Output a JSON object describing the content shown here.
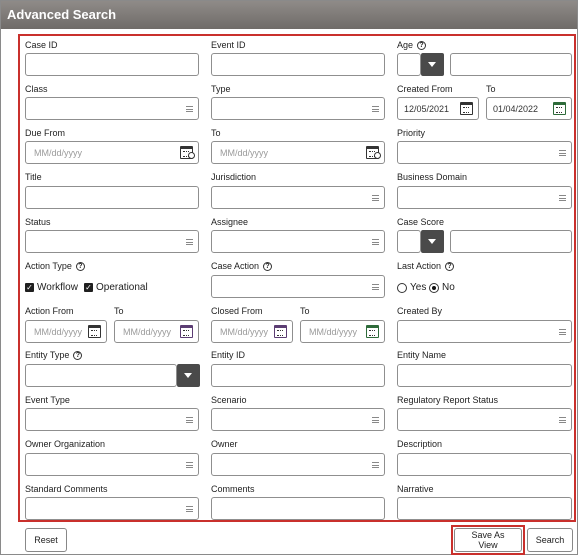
{
  "window": {
    "title": "Advanced Search"
  },
  "fields": {
    "case_id": {
      "label": "Case ID"
    },
    "event_id": {
      "label": "Event ID"
    },
    "age": {
      "label": "Age"
    },
    "class": {
      "label": "Class"
    },
    "type": {
      "label": "Type"
    },
    "created_from": {
      "label": "Created From",
      "value": "12/05/2021"
    },
    "created_to": {
      "label": "To",
      "value": "01/04/2022"
    },
    "due_from": {
      "label": "Due From",
      "placeholder": "MM/dd/yyyy"
    },
    "due_to": {
      "label": "To",
      "placeholder": "MM/dd/yyyy"
    },
    "priority": {
      "label": "Priority"
    },
    "title": {
      "label": "Title"
    },
    "jurisdiction": {
      "label": "Jurisdiction"
    },
    "business_domain": {
      "label": "Business Domain"
    },
    "status": {
      "label": "Status"
    },
    "assignee": {
      "label": "Assignee"
    },
    "case_score": {
      "label": "Case Score"
    },
    "action_type": {
      "label": "Action Type",
      "options": [
        "Workflow",
        "Operational"
      ]
    },
    "case_action": {
      "label": "Case Action"
    },
    "last_action": {
      "label": "Last Action",
      "options": [
        "Yes",
        "No"
      ],
      "selected": "No"
    },
    "action_from": {
      "label": "Action From",
      "placeholder": "MM/dd/yyyy"
    },
    "action_to": {
      "label": "To",
      "placeholder": "MM/dd/yyyy"
    },
    "closed_from": {
      "label": "Closed From",
      "placeholder": "MM/dd/yyyy"
    },
    "closed_to": {
      "label": "To",
      "placeholder": "MM/dd/yyyy"
    },
    "created_by": {
      "label": "Created By"
    },
    "entity_type": {
      "label": "Entity Type"
    },
    "entity_id": {
      "label": "Entity ID"
    },
    "entity_name": {
      "label": "Entity Name"
    },
    "event_type": {
      "label": "Event Type"
    },
    "scenario": {
      "label": "Scenario"
    },
    "regulatory_report_status": {
      "label": "Regulatory Report Status"
    },
    "owner_organization": {
      "label": "Owner Organization"
    },
    "owner": {
      "label": "Owner"
    },
    "description": {
      "label": "Description"
    },
    "standard_comments": {
      "label": "Standard Comments"
    },
    "comments": {
      "label": "Comments"
    },
    "narrative": {
      "label": "Narrative"
    }
  },
  "footer": {
    "reset": "Reset",
    "save_as_view": "Save As View",
    "search": "Search"
  },
  "icons": {
    "help": "?",
    "check": "✓"
  },
  "colors": {
    "highlight": "#c9302c",
    "titlebar": "#7d7976",
    "dropdown": "#4a4a4a"
  }
}
